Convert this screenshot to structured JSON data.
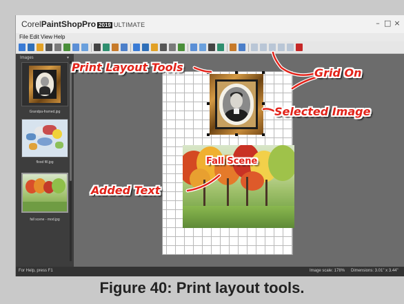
{
  "window": {
    "title_corel": "Corel",
    "title_product": "PaintShop",
    "title_pro": "Pro",
    "title_year": "2019",
    "title_edition": "ULTIMATE",
    "controls": {
      "minimize": "–",
      "restore": "□",
      "close": "×"
    }
  },
  "menubar": {
    "items": [
      "File",
      "Edit",
      "View",
      "Help"
    ]
  },
  "toolbar": {
    "icons": [
      "new-icon",
      "open-icon",
      "save-icon",
      "open-template-icon",
      "print-icon",
      "print-setup-icon",
      "undo-icon",
      "redo-icon",
      "text-icon",
      "rotate-icon",
      "flip-icon",
      "refresh-icon",
      "fit-icon",
      "arrange-icon",
      "layout-icon",
      "layout-alt-icon",
      "layout-icon-3",
      "print-layout-icon",
      "zoom-icon",
      "zoom-in-icon",
      "zoom-out-icon",
      "zoom-fit-icon",
      "grid-icon",
      "grid-snap-icon",
      "align-icon-1",
      "align-icon-2",
      "align-icon-3",
      "align-icon-4",
      "align-icon-5",
      "close-layout-icon"
    ]
  },
  "organizer": {
    "title": "Images",
    "items": [
      {
        "label": "Grandpa-framed.jpg"
      },
      {
        "label": "flood fill.jpg"
      },
      {
        "label": "fall scene - mod.jpg"
      }
    ]
  },
  "canvas": {
    "overlay_text": "Fall Scene"
  },
  "statusbar": {
    "help": "For Help, press F1",
    "scale": "Image scale: 178%",
    "dimensions": "Dimensions: 3.01\" x 3.44\""
  },
  "annotations": {
    "print_layout_tools": "Print Layout Tools",
    "grid_on": "Grid On",
    "selected_image": "Selected Image",
    "added_text": "Added Text"
  },
  "caption": "Figure 40: Print layout tools.",
  "colors": {
    "callout_red": "#e2231a",
    "workspace_gray": "#6c6c6c",
    "organizer_dark": "#3d3d3d"
  }
}
